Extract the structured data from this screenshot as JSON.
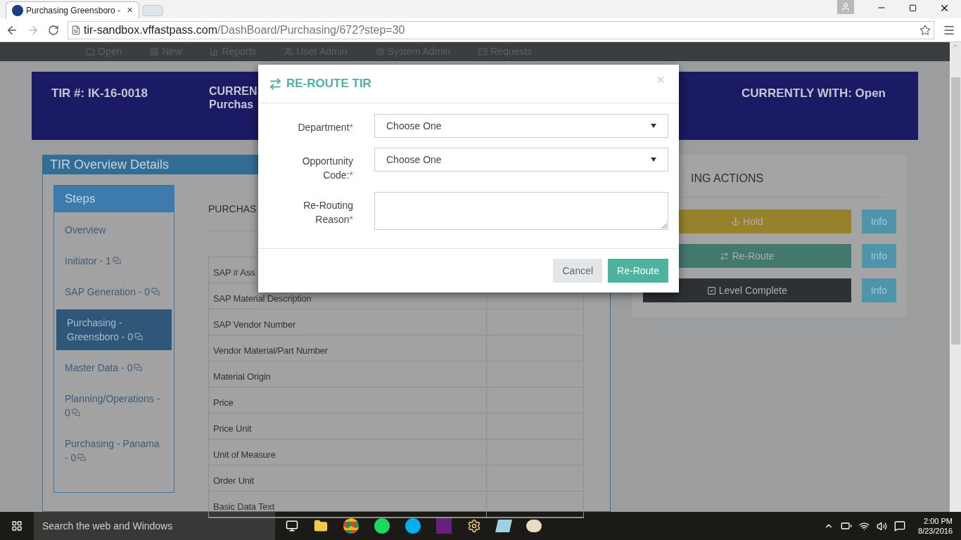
{
  "browser": {
    "tabs": [
      {
        "title": "Purchasing Greensboro -",
        "selected": true
      }
    ],
    "close": "×",
    "url_host": "tir-sandbox.vffastpass.com",
    "url_path": "/DashBoard/Purchasing/672?step=30"
  },
  "nav": [
    "Open",
    "New",
    "Reports",
    "User Admin",
    "System Admin",
    "Requests"
  ],
  "banner": {
    "tir": "TIR #: IK-16-0018",
    "current_step": [
      "CURREN",
      "Purchas"
    ],
    "currently_with": "CURRENTLY WITH: Open"
  },
  "overview": {
    "title": "TIR Overview Details",
    "steps_title": "Steps",
    "steps": [
      {
        "label": "Overview",
        "comments": false,
        "selected": false
      },
      {
        "label": "Initiator - 1",
        "comments": true,
        "selected": false
      },
      {
        "label": "SAP Generation - 0",
        "comments": true,
        "selected": false
      },
      {
        "label": "Purchasing - Greensboro - 0",
        "comments": true,
        "selected": true
      },
      {
        "label": "Master Data - 0",
        "comments": true,
        "selected": false
      },
      {
        "label": "Planning/Operations - 0",
        "comments": true,
        "selected": false
      },
      {
        "label": "Purchasing - Panama - 0",
        "comments": true,
        "selected": false
      }
    ],
    "section_heading": "PURCHAS",
    "rows": [
      "SAP # Ass",
      "SAP Material Description",
      "SAP Vendor Number",
      "Vendor Material/Part Number",
      "Material Origin",
      "Price",
      "Price Unit",
      "Unit of Measure",
      "Order Unit",
      "Basic Data Text"
    ]
  },
  "actions": {
    "heading": "ING ACTIONS",
    "buttons": [
      {
        "label": "Hold",
        "kind": "hold",
        "info": "Info"
      },
      {
        "label": "Re-Route",
        "kind": "reroute",
        "info": "Info"
      },
      {
        "label": "Level Complete",
        "kind": "complete",
        "info": "Info"
      }
    ]
  },
  "modal": {
    "title": "RE-ROUTE TIR",
    "close": "×",
    "fields": [
      {
        "label": "Department",
        "marker": "*",
        "kind": "select",
        "value": "Choose One"
      },
      {
        "label": "Opportunity Code:",
        "marker": "*",
        "kind": "select",
        "value": "Choose One"
      },
      {
        "label": "Re-Routing Reason",
        "marker": "*",
        "kind": "textarea"
      }
    ],
    "buttons": [
      {
        "label": "Cancel",
        "kind": "secondary"
      },
      {
        "label": "Re-Route",
        "kind": "primary"
      }
    ]
  },
  "taskbar": {
    "search": "Search the web and Windows",
    "time": "2:00 PM",
    "date": "8/23/2016"
  }
}
